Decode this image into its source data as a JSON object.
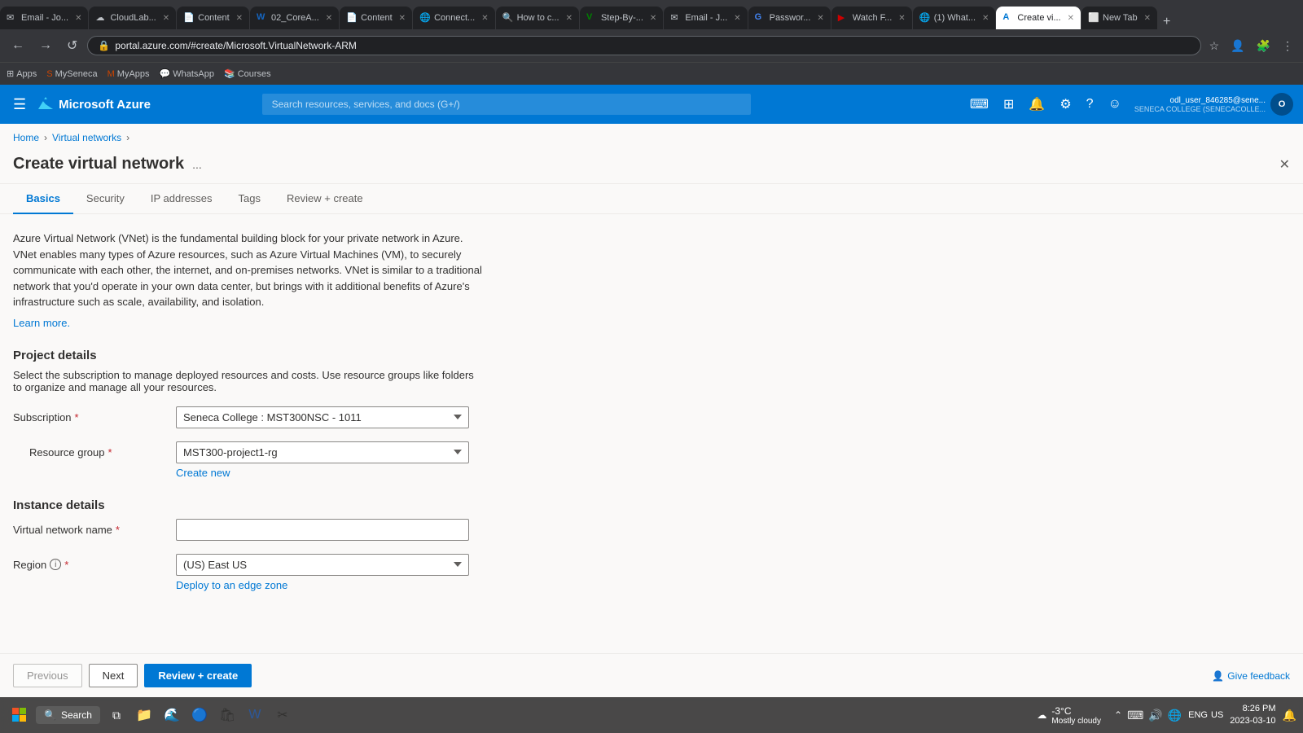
{
  "browser": {
    "address": "portal.azure.com/#create/Microsoft.VirtualNetwork-ARM",
    "tabs": [
      {
        "id": 1,
        "label": "Email - Jo...",
        "favicon": "✉",
        "active": false
      },
      {
        "id": 2,
        "label": "CloudLab...",
        "favicon": "☁",
        "active": false
      },
      {
        "id": 3,
        "label": "Content",
        "favicon": "📄",
        "active": false
      },
      {
        "id": 4,
        "label": "02_CoreA...",
        "favicon": "W",
        "active": false
      },
      {
        "id": 5,
        "label": "Content",
        "favicon": "📄",
        "active": false
      },
      {
        "id": 6,
        "label": "Connect...",
        "favicon": "🌐",
        "active": false
      },
      {
        "id": 7,
        "label": "How to c...",
        "favicon": "🔍",
        "active": false
      },
      {
        "id": 8,
        "label": "Step-By-...",
        "favicon": "V",
        "active": false
      },
      {
        "id": 9,
        "label": "Email - J...",
        "favicon": "✉",
        "active": false
      },
      {
        "id": 10,
        "label": "Passwor...",
        "favicon": "G",
        "active": false
      },
      {
        "id": 11,
        "label": "Watch F...",
        "favicon": "▶",
        "active": false
      },
      {
        "id": 12,
        "label": "(1) What...",
        "favicon": "🌐",
        "active": false
      },
      {
        "id": 13,
        "label": "Create vi...",
        "favicon": "A",
        "active": true
      },
      {
        "id": 14,
        "label": "New Tab",
        "favicon": "⬜",
        "active": false
      }
    ],
    "bookmarks": [
      "Apps",
      "MySeneca",
      "MyApps",
      "WhatsApp",
      "Courses"
    ]
  },
  "azure": {
    "topbar": {
      "logo": "Microsoft Azure",
      "search_placeholder": "Search resources, services, and docs (G+/)"
    },
    "user": {
      "name": "odl_user_846285@sene...",
      "org": "SENECA COLLEGE (SENECACOLLE...",
      "initials": "O"
    },
    "breadcrumb": {
      "home": "Home",
      "parent": "Virtual networks",
      "current": ""
    },
    "page": {
      "title": "Create virtual network",
      "more_actions": "..."
    },
    "tabs": [
      {
        "id": "basics",
        "label": "Basics",
        "active": true
      },
      {
        "id": "security",
        "label": "Security",
        "active": false
      },
      {
        "id": "ip",
        "label": "IP addresses",
        "active": false
      },
      {
        "id": "tags",
        "label": "Tags",
        "active": false
      },
      {
        "id": "review",
        "label": "Review + create",
        "active": false
      }
    ],
    "description": "Azure Virtual Network (VNet) is the fundamental building block for your private network in Azure. VNet enables many types of Azure resources, such as Azure Virtual Machines (VM), to securely communicate with each other, the internet, and on-premises networks. VNet is similar to a traditional network that you'd operate in your own data center, but brings with it additional benefits of Azure's infrastructure such as scale, availability, and isolation.",
    "learn_more": "Learn more.",
    "sections": {
      "project_details": {
        "title": "Project details",
        "description": "Select the subscription to manage deployed resources and costs. Use resource groups like folders to organize and manage all your resources."
      },
      "instance_details": {
        "title": "Instance details"
      }
    },
    "form": {
      "subscription": {
        "label": "Subscription",
        "required": true,
        "value": "Seneca College : MST300NSC - 1011"
      },
      "resource_group": {
        "label": "Resource group",
        "required": true,
        "value": "MST300-project1-rg",
        "create_new": "Create new"
      },
      "vnet_name": {
        "label": "Virtual network name",
        "required": true,
        "value": "",
        "placeholder": ""
      },
      "region": {
        "label": "Region",
        "required": true,
        "has_info": true,
        "value": "(US) East US",
        "deploy_link": "Deploy to an edge zone"
      }
    },
    "buttons": {
      "previous": "Previous",
      "next": "Next",
      "review": "Review + create",
      "feedback": "Give feedback"
    }
  },
  "taskbar": {
    "search_label": "Search",
    "weather": "-3°C",
    "weather_desc": "Mostly cloudy",
    "lang": "ENG",
    "region": "US",
    "time": "8:26 PM",
    "date": "2023-03-10"
  }
}
